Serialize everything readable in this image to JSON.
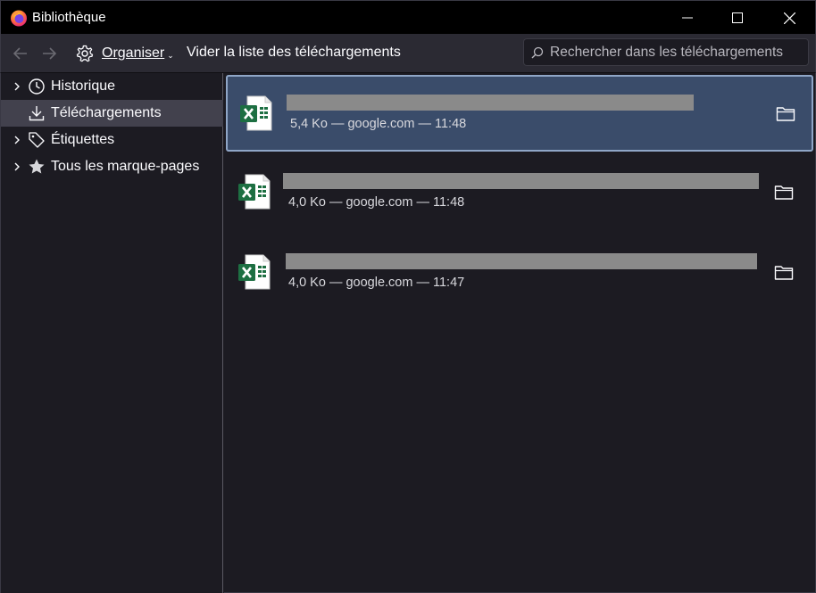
{
  "window": {
    "title": "Bibliothèque"
  },
  "toolbar": {
    "organize_label": "Organiser",
    "clear_label": "Vider la liste des téléchargements",
    "search_placeholder": "Rechercher dans les téléchargements"
  },
  "sidebar": {
    "items": [
      {
        "label": "Historique",
        "icon": "clock-icon",
        "expandable": true,
        "selected": false
      },
      {
        "label": "Téléchargements",
        "icon": "download-icon",
        "expandable": false,
        "selected": true
      },
      {
        "label": "Étiquettes",
        "icon": "tags-icon",
        "expandable": true,
        "selected": false
      },
      {
        "label": "Tous les marque-pages",
        "icon": "star-icon",
        "expandable": true,
        "selected": false
      }
    ]
  },
  "downloads": [
    {
      "name": "",
      "meta": "5,4 Ko — google.com — 11:48",
      "file_type": "excel",
      "selected": true
    },
    {
      "name": "",
      "meta": "4,0 Ko — google.com — 11:48",
      "file_type": "excel",
      "selected": false
    },
    {
      "name": "",
      "meta": "4,0 Ko — google.com — 11:47",
      "file_type": "excel",
      "selected": false
    }
  ],
  "colors": {
    "background": "#1c1b22",
    "toolbar": "#2b2a33",
    "selected_item": "#3a4c6a",
    "excel_green": "#1d6f42"
  }
}
